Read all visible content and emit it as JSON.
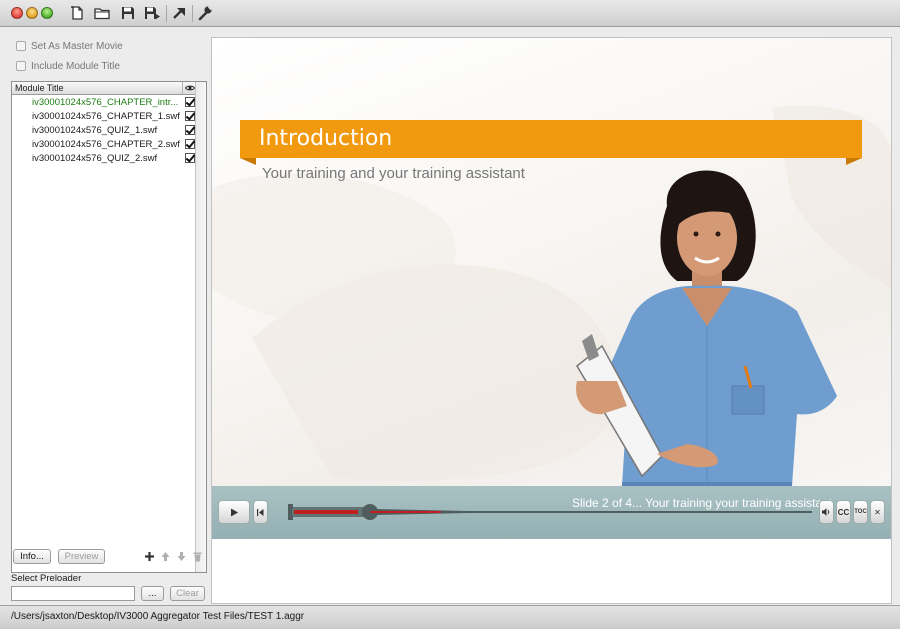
{
  "toolbar": {
    "buttons": [
      "new-file-icon",
      "open-folder-icon",
      "save-icon",
      "save-as-icon",
      "publish-icon",
      "settings-wrench-icon"
    ]
  },
  "left_panel": {
    "master_movie_label": "Set As Master Movie",
    "include_title_label": "Include Module Title",
    "table": {
      "header_title": "Module Title",
      "visibility_icon": "eye-icon",
      "rows": [
        {
          "name": "iv30001024x576_CHAPTER_intr...",
          "checked": true,
          "active": true
        },
        {
          "name": "iv30001024x576_CHAPTER_1.swf",
          "checked": true,
          "active": false
        },
        {
          "name": "iv30001024x576_QUIZ_1.swf",
          "checked": true,
          "active": false
        },
        {
          "name": "iv30001024x576_CHAPTER_2.swf",
          "checked": true,
          "active": false
        },
        {
          "name": "iv30001024x576_QUIZ_2.swf",
          "checked": true,
          "active": false
        }
      ]
    },
    "info_button": "Info...",
    "preview_button": "Preview",
    "order_icons": [
      "add-icon",
      "move-up-icon",
      "move-down-icon",
      "trash-icon"
    ],
    "preloader_label": "Select Preloader",
    "preloader_value": "",
    "browse_button": "...",
    "clear_button": "Clear"
  },
  "preview": {
    "expand_icon": "double-chevron-right-icon",
    "title": "Introduction",
    "subtitle": "Your training and your training assistant",
    "status": "Slide 2 of 4... Your training  your training assistant",
    "progress": 0.16,
    "cc_label": "CC",
    "toc_label": "TOC",
    "close_label": "✕",
    "colors": {
      "banner": "#f29a0f",
      "player_bar": "#9fb9bc",
      "active_module": "#1d7d12"
    }
  },
  "statusbar": {
    "path": "/Users/jsaxton/Desktop/IV3000 Aggregator Test Files/TEST 1.aggr"
  }
}
